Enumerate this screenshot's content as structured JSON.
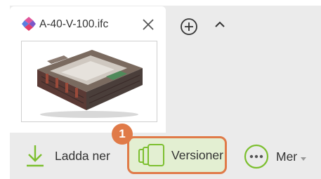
{
  "tab": {
    "file_name": "A-40-V-100.ifc",
    "file_icon": "ifc-file-icon",
    "close_icon": "close-icon",
    "thumbnail": "building-model-preview"
  },
  "tab_bar": {
    "add_icon": "plus-circle-icon",
    "collapse_icon": "chevron-up-icon"
  },
  "toolbar": {
    "download_label": "Ladda ner",
    "versions_label": "Versioner",
    "more_label": "Mer"
  },
  "annotation": {
    "step_number": "1"
  },
  "colors": {
    "accent_green": "#7cbf2f",
    "highlight_orange": "#e07a48",
    "highlight_fill": "#e3efd2"
  }
}
